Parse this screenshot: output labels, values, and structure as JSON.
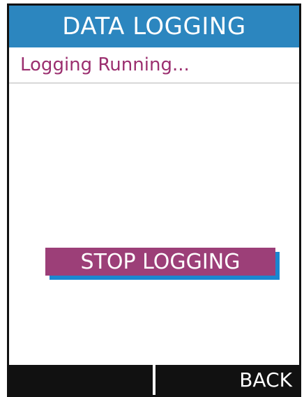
{
  "screen": {
    "title": "DATA LOGGING",
    "status_text": "Logging Running..."
  },
  "actions": {
    "stop_label": "STOP LOGGING"
  },
  "softkeys": {
    "left_label": "",
    "right_label": "BACK"
  },
  "colors": {
    "title_bar": "#2c86bf",
    "status_text": "#9b2f6f",
    "button_fill": "#9c3f78",
    "button_shadow": "#1a86d0",
    "softkey_bar": "#111111"
  }
}
